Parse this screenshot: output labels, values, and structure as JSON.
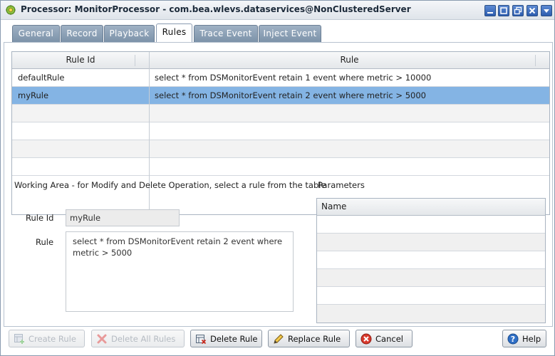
{
  "window": {
    "title": "Processor: MonitorProcessor - com.bea.wlevs.dataservices@NonClusteredServer"
  },
  "tabs": [
    {
      "label": "General"
    },
    {
      "label": "Record"
    },
    {
      "label": "Playback"
    },
    {
      "label": "Rules",
      "active": true
    },
    {
      "label": "Trace Event"
    },
    {
      "label": "Inject Event"
    }
  ],
  "rules_table": {
    "columns": [
      "Rule Id",
      "Rule"
    ],
    "rows": [
      {
        "rule_id": "defaultRule",
        "rule": "select * from DSMonitorEvent retain 1 event where metric > 10000"
      },
      {
        "rule_id": "myRule",
        "rule": "select * from DSMonitorEvent retain 2 event where metric > 5000",
        "selected": true
      }
    ]
  },
  "working_area": {
    "label": "Working Area - for Modify and Delete Operation, select a rule from the table",
    "rule_id_label": "Rule Id",
    "rule_id_value": "myRule",
    "rule_label": "Rule",
    "rule_value": "select * from DSMonitorEvent retain 2 event where metric > 5000"
  },
  "parameters": {
    "label": "Parameters",
    "column": "Name"
  },
  "buttons": {
    "create_rule": "Create Rule",
    "delete_all_rules": "Delete All Rules",
    "delete_rule": "Delete Rule",
    "replace_rule": "Replace Rule",
    "cancel": "Cancel",
    "help": "Help"
  },
  "colors": {
    "selected_row": "#84b4e4",
    "tab_inactive": "#8a9fb5",
    "title_buttons": "#2c5cae"
  }
}
